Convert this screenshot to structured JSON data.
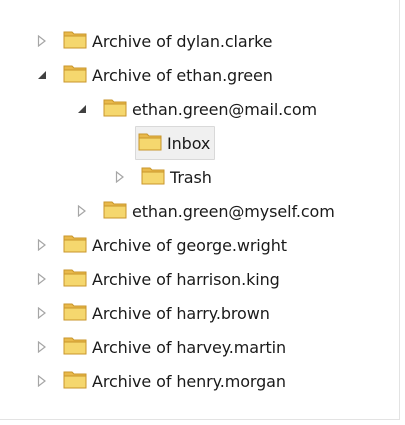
{
  "tree": {
    "items": [
      {
        "label": "Archive of dylan.clarke",
        "level": 0,
        "expander": "collapsed"
      },
      {
        "label": "Archive of ethan.green",
        "level": 0,
        "expander": "expanded"
      },
      {
        "label": "ethan.green@mail.com",
        "level": 1,
        "expander": "expanded"
      },
      {
        "label": "Inbox",
        "level": 2,
        "expander": "none",
        "selected": true
      },
      {
        "label": "Trash",
        "level": 2,
        "expander": "collapsed"
      },
      {
        "label": "ethan.green@myself.com",
        "level": 1,
        "expander": "collapsed"
      },
      {
        "label": "Archive of george.wright",
        "level": 0,
        "expander": "collapsed"
      },
      {
        "label": "Archive of harrison.king",
        "level": 0,
        "expander": "collapsed"
      },
      {
        "label": "Archive of harry.brown",
        "level": 0,
        "expander": "collapsed"
      },
      {
        "label": "Archive of harvey.martin",
        "level": 0,
        "expander": "collapsed"
      },
      {
        "label": "Archive of henry.morgan",
        "level": 0,
        "expander": "collapsed"
      }
    ]
  },
  "colors": {
    "folder_body": "#f5d76e",
    "folder_tab": "#e9b94b",
    "folder_outline": "#c9962b",
    "expander_collapsed": "#a6a6a6",
    "expander_expanded": "#404040",
    "selection_bg": "#f0f0f0"
  },
  "icons": {
    "folder": "folder-icon",
    "collapsed": "expand-arrow-icon",
    "expanded": "collapse-arrow-icon"
  }
}
